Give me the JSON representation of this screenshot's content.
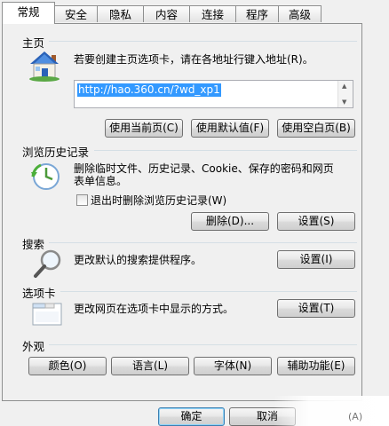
{
  "tabs": [
    {
      "label": "常规",
      "active": true
    },
    {
      "label": "安全",
      "active": false
    },
    {
      "label": "隐私",
      "active": false
    },
    {
      "label": "内容",
      "active": false
    },
    {
      "label": "连接",
      "active": false
    },
    {
      "label": "程序",
      "active": false
    },
    {
      "label": "高级",
      "active": false
    }
  ],
  "home": {
    "label": "主页",
    "description": "若要创建主页选项卡，请在各地址行键入地址(R)。",
    "url": "http://hao.360.cn/?wd_xp1",
    "buttons": {
      "use_current": "使用当前页(C)",
      "use_default": "使用默认值(F)",
      "use_blank": "使用空白页(B)"
    }
  },
  "history": {
    "label": "浏览历史记录",
    "description_line1": "删除临时文件、历史记录、Cookie、保存的密码和网页",
    "description_line2": "表单信息。",
    "checkbox_label": "退出时删除浏览历史记录(W)",
    "checkbox_checked": false,
    "buttons": {
      "delete": "删除(D)...",
      "settings": "设置(S)"
    }
  },
  "search": {
    "label": "搜索",
    "description": "更改默认的搜索提供程序。",
    "settings_button": "设置(I)"
  },
  "tabs_section": {
    "label": "选项卡",
    "description": "更改网页在选项卡中显示的方式。",
    "settings_button": "设置(T)"
  },
  "appearance": {
    "label": "外观",
    "buttons": {
      "colors": "颜色(O)",
      "languages": "语言(L)",
      "fonts": "字体(N)",
      "accessibility": "辅助功能(E)"
    }
  },
  "footer": {
    "ok": "确定",
    "cancel": "取消",
    "apply": "(A)"
  },
  "colors": {
    "accent": "#3399ff",
    "panel": "#f0f0f0",
    "border": "#8e8f8f"
  }
}
